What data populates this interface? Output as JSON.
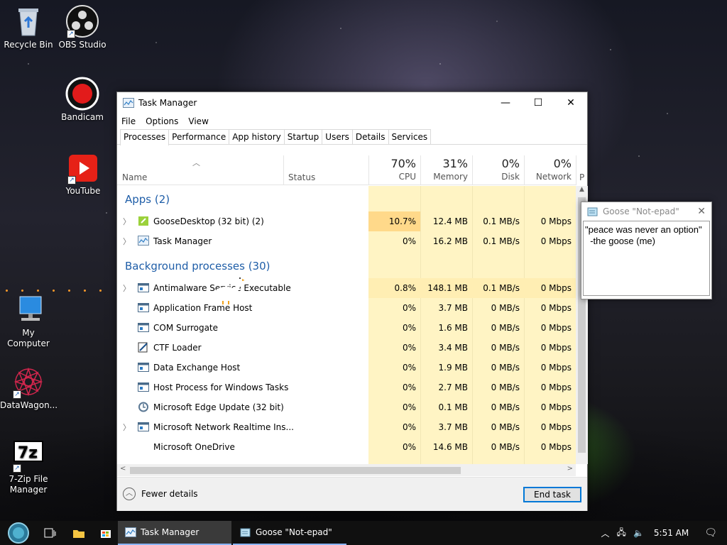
{
  "desktop": {
    "icons": [
      {
        "label": "Recycle Bin",
        "icon": "recycle-bin-icon"
      },
      {
        "label": "OBS Studio",
        "icon": "obs-icon"
      },
      {
        "label": "Bandicam",
        "icon": "bandicam-icon"
      },
      {
        "label": "YouTube",
        "icon": "youtube-icon"
      },
      {
        "label": "My Computer",
        "icon": "computer-icon"
      },
      {
        "label": "DataWagon...",
        "icon": "datawagon-icon"
      },
      {
        "label": "7-Zip File Manager",
        "icon": "7zip-icon"
      }
    ]
  },
  "taskmanager": {
    "title": "Task Manager",
    "menu": [
      "File",
      "Options",
      "View"
    ],
    "tabs": [
      "Processes",
      "Performance",
      "App history",
      "Startup",
      "Users",
      "Details",
      "Services"
    ],
    "columns": {
      "name": "Name",
      "status": "Status",
      "cpu": {
        "pct": "70%",
        "label": "CPU"
      },
      "memory": {
        "pct": "31%",
        "label": "Memory"
      },
      "disk": {
        "pct": "0%",
        "label": "Disk"
      },
      "network": {
        "pct": "0%",
        "label": "Network"
      },
      "power": "P"
    },
    "groups": {
      "apps": "Apps (2)",
      "background": "Background processes (30)"
    },
    "apps": [
      {
        "name": "GooseDesktop (32 bit) (2)",
        "cpu": "10.7%",
        "memory": "12.4 MB",
        "disk": "0.1 MB/s",
        "network": "0 Mbps"
      },
      {
        "name": "Task Manager",
        "cpu": "0%",
        "memory": "16.2 MB",
        "disk": "0.1 MB/s",
        "network": "0 Mbps"
      }
    ],
    "background": [
      {
        "name": "Antimalware Service Executable",
        "cpu": "0.8%",
        "memory": "148.1 MB",
        "disk": "0.1 MB/s",
        "network": "0 Mbps"
      },
      {
        "name": "Application Frame Host",
        "cpu": "0%",
        "memory": "3.7 MB",
        "disk": "0 MB/s",
        "network": "0 Mbps"
      },
      {
        "name": "COM Surrogate",
        "cpu": "0%",
        "memory": "1.6 MB",
        "disk": "0 MB/s",
        "network": "0 Mbps"
      },
      {
        "name": "CTF Loader",
        "cpu": "0%",
        "memory": "3.4 MB",
        "disk": "0 MB/s",
        "network": "0 Mbps"
      },
      {
        "name": "Data Exchange Host",
        "cpu": "0%",
        "memory": "1.9 MB",
        "disk": "0 MB/s",
        "network": "0 Mbps"
      },
      {
        "name": "Host Process for Windows Tasks",
        "cpu": "0%",
        "memory": "2.7 MB",
        "disk": "0 MB/s",
        "network": "0 Mbps"
      },
      {
        "name": "Microsoft Edge Update (32 bit)",
        "cpu": "0%",
        "memory": "0.1 MB",
        "disk": "0 MB/s",
        "network": "0 Mbps"
      },
      {
        "name": "Microsoft Network Realtime Ins...",
        "cpu": "0%",
        "memory": "3.7 MB",
        "disk": "0 MB/s",
        "network": "0 Mbps"
      },
      {
        "name": "Microsoft OneDrive",
        "cpu": "0%",
        "memory": "14.6 MB",
        "disk": "0 MB/s",
        "network": "0 Mbps"
      }
    ],
    "footer": {
      "fewer_details": "Fewer details",
      "end_task": "End task"
    }
  },
  "notepad": {
    "title": "Goose \"Not-epad\"",
    "lines": [
      "\"peace was never an option\"",
      "  -the goose (me)"
    ]
  },
  "taskbar": {
    "items": [
      {
        "label": "Task Manager"
      },
      {
        "label": "Goose \"Not-epad\""
      }
    ],
    "clock": "5:51 AM"
  },
  "colors": {
    "accent": "#0078d7",
    "group_blue": "#1f5ea8",
    "heat_high": "#ffe9a8",
    "heat_low": "#fff4c4"
  }
}
